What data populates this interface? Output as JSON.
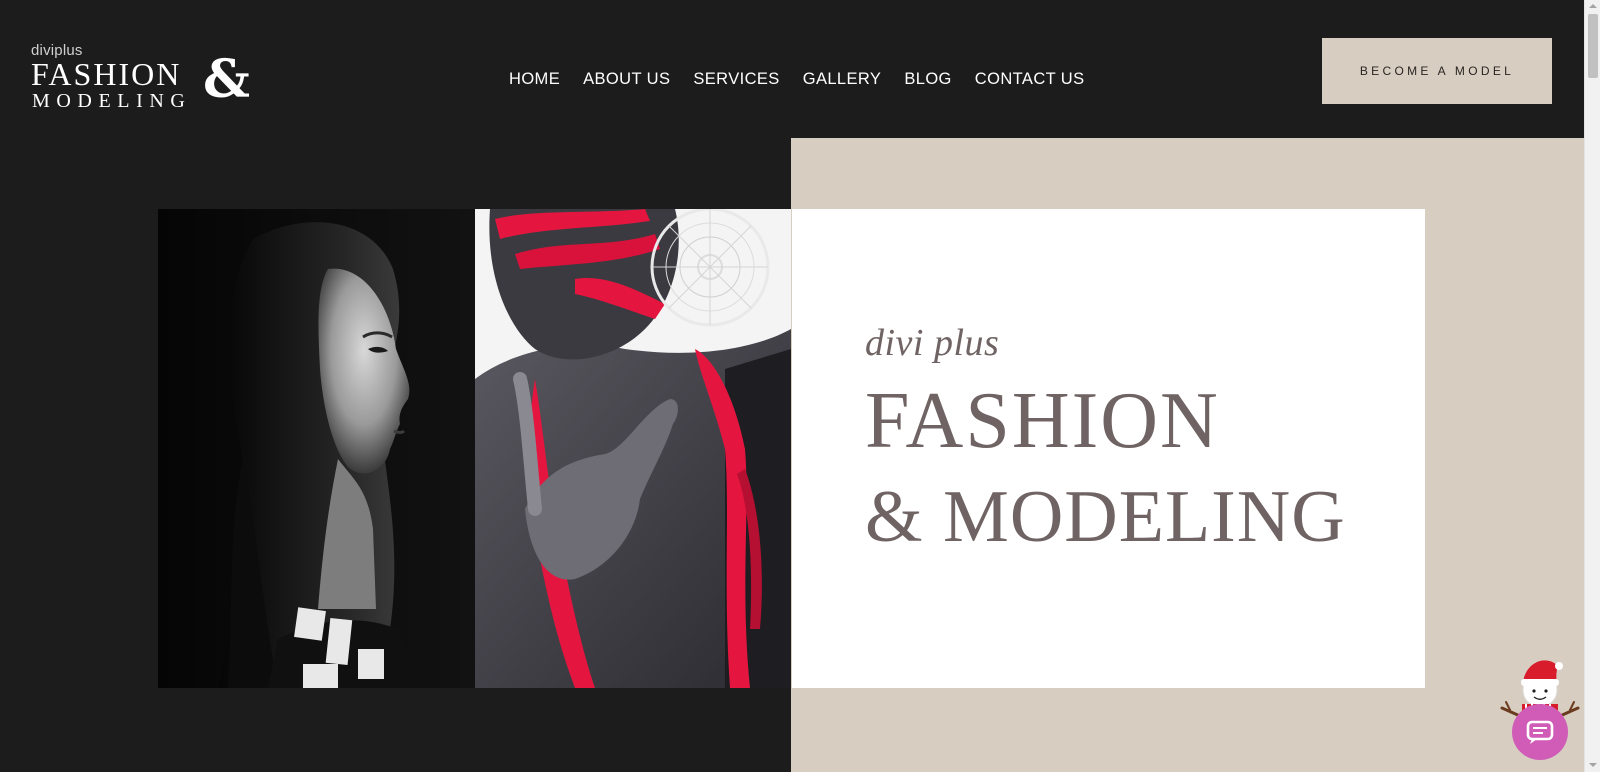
{
  "header": {
    "logo": {
      "small": "diviplus",
      "fashion": "FASHION",
      "amp": "&",
      "modeling": "MODELING"
    },
    "nav": [
      {
        "label": "HOME"
      },
      {
        "label": "ABOUT US"
      },
      {
        "label": "SERVICES"
      },
      {
        "label": "GALLERY"
      },
      {
        "label": "BLOG"
      },
      {
        "label": "CONTACT US"
      }
    ],
    "cta_label": "BECOME A MODEL"
  },
  "hero": {
    "script_text": "divi plus",
    "title_line1": "FASHION",
    "title_line2": "& MODELING"
  },
  "colors": {
    "background": "#1c1c1c",
    "beige": "#d7cdc1",
    "title": "#6f6363",
    "accent_red": "#e4163f",
    "chat_pink": "#d05cb7"
  },
  "icons": {
    "chat": "chat-bubble-icon",
    "mascot": "snowman-icon"
  }
}
